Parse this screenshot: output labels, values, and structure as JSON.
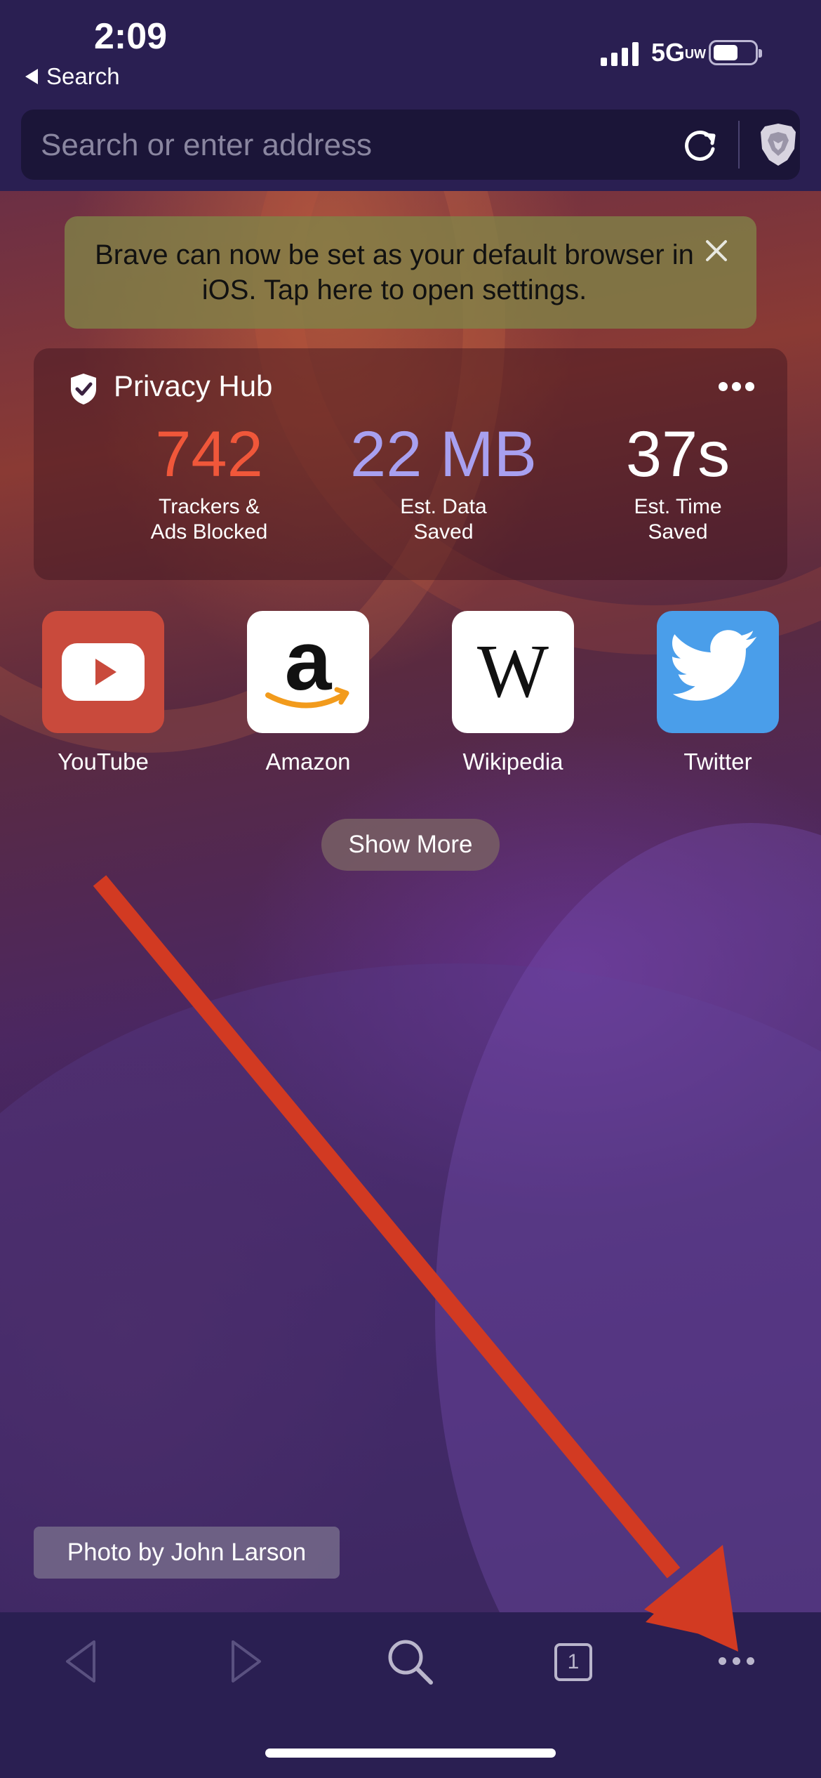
{
  "status_bar": {
    "time": "2:09",
    "back_app": "Search",
    "network": "5G",
    "network_sub": "UW"
  },
  "address_bar": {
    "placeholder": "Search or enter address"
  },
  "banner": {
    "text": "Brave can now be set as your default browser in iOS. Tap here to open settings."
  },
  "privacy_hub": {
    "title": "Privacy Hub",
    "stats": [
      {
        "value": "742",
        "label_line1": "Trackers &",
        "label_line2": "Ads Blocked",
        "color": "#f0573a"
      },
      {
        "value": "22 MB",
        "label_line1": "Est. Data",
        "label_line2": "Saved",
        "color": "#a8a0f0"
      },
      {
        "value": "37s",
        "label_line1": "Est. Time",
        "label_line2": "Saved",
        "color": "#ffffff"
      }
    ]
  },
  "favorites": [
    {
      "label": "YouTube",
      "icon": "youtube-icon",
      "color": "#c94a3c"
    },
    {
      "label": "Amazon",
      "icon": "amazon-icon",
      "color": "#ffffff"
    },
    {
      "label": "Wikipedia",
      "icon": "wikipedia-icon",
      "color": "#ffffff",
      "glyph": "W"
    },
    {
      "label": "Twitter",
      "icon": "twitter-icon",
      "color": "#4a9eea"
    }
  ],
  "show_more": "Show More",
  "photo_credit": "Photo by John Larson",
  "toolbar": {
    "tab_count": "1"
  },
  "annotation": {
    "color": "#d23a22"
  }
}
